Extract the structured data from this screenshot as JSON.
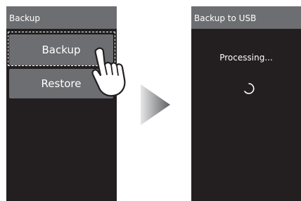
{
  "left_screen": {
    "title": "Backup",
    "buttons": {
      "backup": "Backup",
      "restore": "Restore"
    }
  },
  "right_screen": {
    "title": "Backup to USB",
    "status": "Processing..."
  },
  "icons": {
    "pointer": "hand-pointer-icon",
    "next": "play-arrow-icon",
    "spinner": "loading-spinner-icon"
  },
  "colors": {
    "screen_bg": "#231f20",
    "bar_bg": "#6d6e71",
    "text": "#ffffff"
  }
}
